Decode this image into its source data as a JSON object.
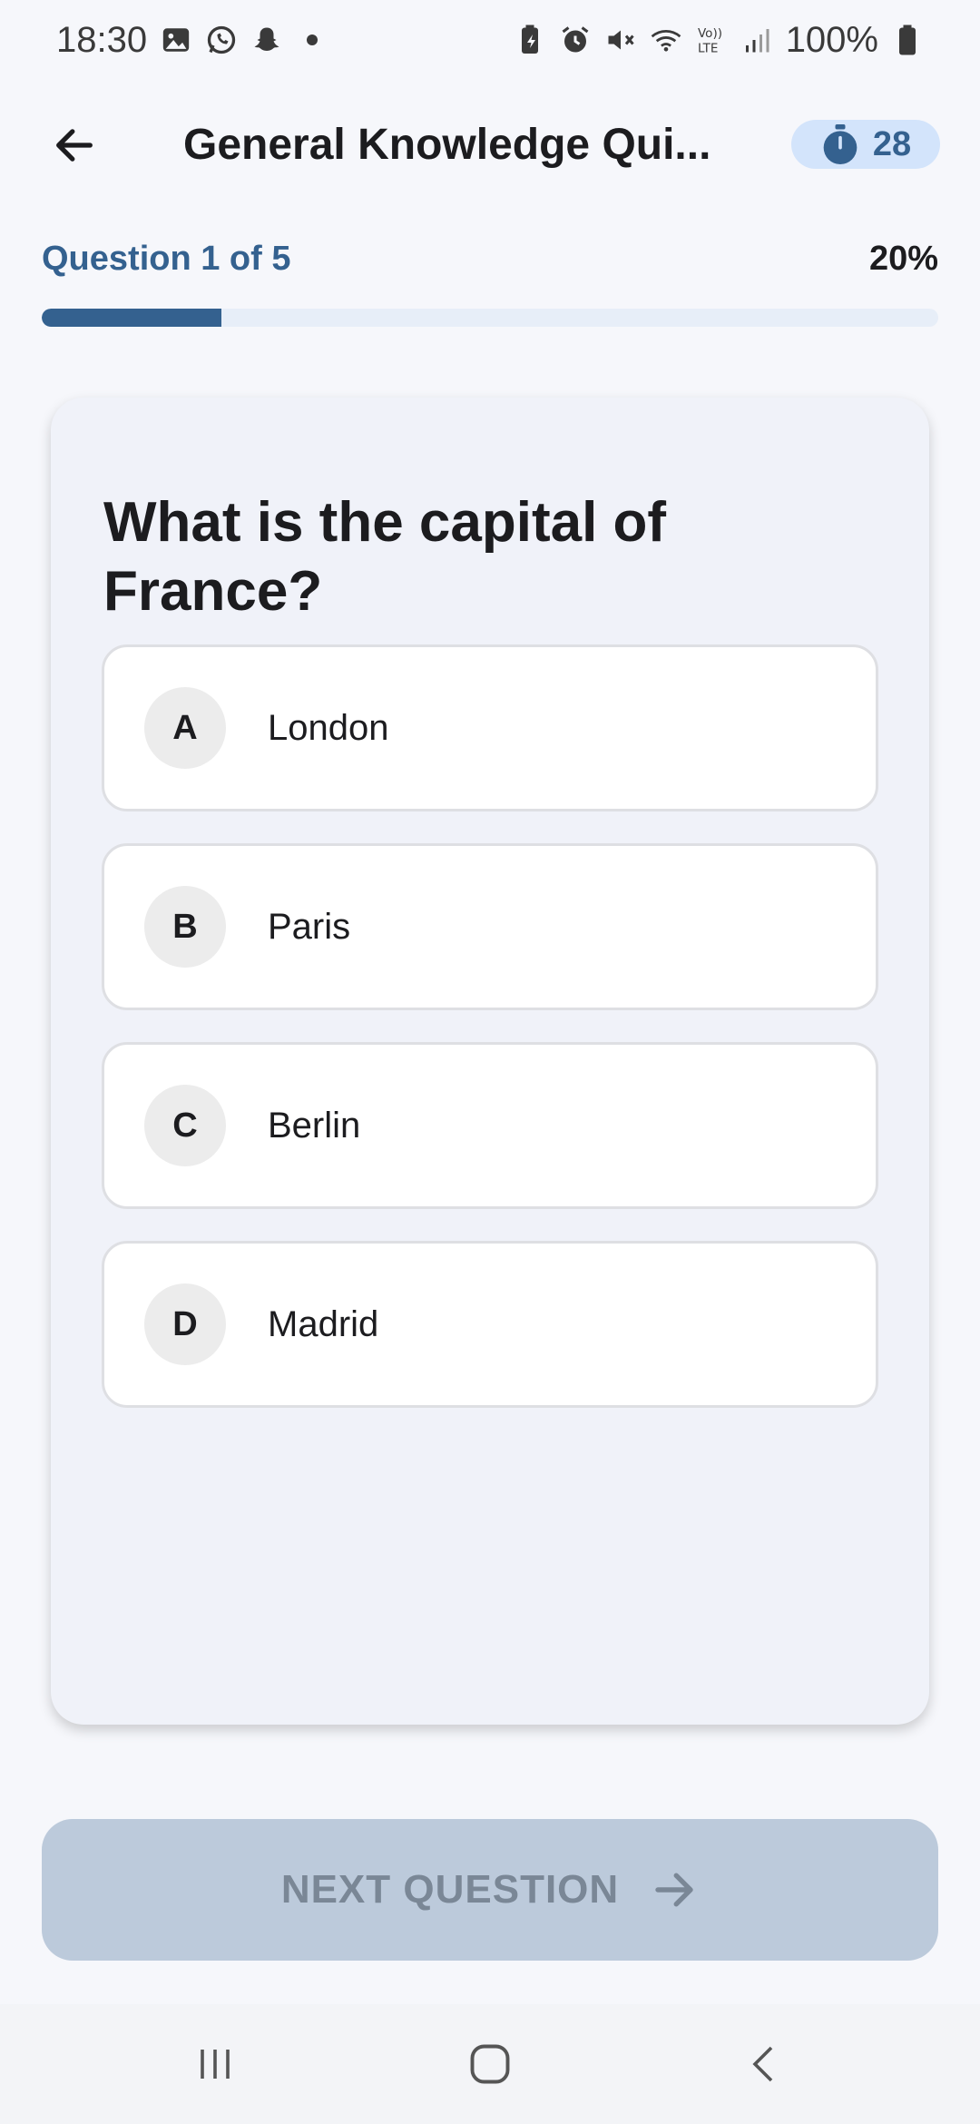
{
  "status_bar": {
    "time": "18:30",
    "battery": "100%",
    "left_icons": [
      "gallery-icon",
      "whatsapp-icon",
      "snapchat-icon"
    ],
    "right_icons": [
      "battery-saver-icon",
      "alarm-icon",
      "mute-icon",
      "wifi-icon",
      "volte-icon",
      "signal-icon",
      "battery-icon"
    ]
  },
  "app_bar": {
    "title": "General Knowledge Qui...",
    "timer_value": "28",
    "back_icon": "arrow-left-icon",
    "timer_icon": "stopwatch-icon"
  },
  "progress": {
    "label": "Question 1 of 5",
    "percent_label": "20%",
    "fraction": 0.2
  },
  "question": {
    "text": "What is the capital of France?",
    "options": [
      {
        "letter": "A",
        "text": "London"
      },
      {
        "letter": "B",
        "text": "Paris"
      },
      {
        "letter": "C",
        "text": "Berlin"
      },
      {
        "letter": "D",
        "text": "Madrid"
      }
    ]
  },
  "next_button": {
    "label": "NEXT QUESTION",
    "icon": "arrow-right-icon",
    "enabled": false
  },
  "nav_bar": {
    "icons": [
      "recents-icon",
      "home-icon",
      "back-icon"
    ]
  },
  "colors": {
    "accent": "#34618f",
    "timer_bg": "#d3e4fb",
    "button_disabled_bg": "#bccadb",
    "card_bg": "#f0f2f9"
  }
}
